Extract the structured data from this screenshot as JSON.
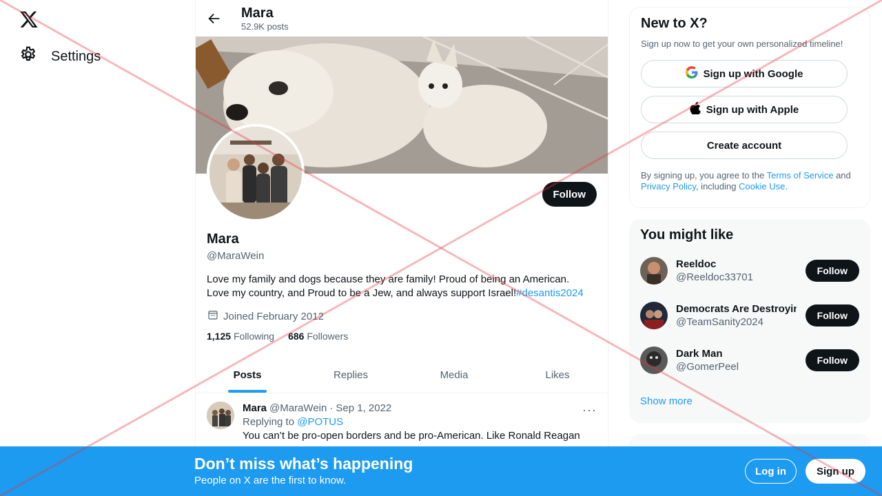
{
  "nav": {
    "settings_label": "Settings"
  },
  "topbar": {
    "name": "Mara",
    "posts": "52.9K posts"
  },
  "profile": {
    "follow_label": "Follow",
    "name": "Mara",
    "handle": "@MaraWein",
    "bio_line1": "Love my family and dogs because they are family! Proud of being an American.",
    "bio_line2": "Love my country, and Proud to be a Jew, and always support Israel!",
    "bio_hashtag": "#desantis2024",
    "joined": "Joined February 2012",
    "following_count": "1,125",
    "following_label": "Following",
    "followers_count": "686",
    "followers_label": "Followers"
  },
  "tabs": [
    {
      "label": "Posts"
    },
    {
      "label": "Replies"
    },
    {
      "label": "Media"
    },
    {
      "label": "Likes"
    }
  ],
  "tweet": {
    "name": "Mara",
    "handle": "@MaraWein",
    "separator": "·",
    "date": "Sep 1, 2022",
    "more": "···",
    "replying_prefix": "Replying to",
    "replying_handle": "@POTUS",
    "text": "You can’t be pro-open borders and be pro-American.  Like Ronald Reagan"
  },
  "new_to_x": {
    "title": "New to X?",
    "subtitle": "Sign up now to get your own personalized timeline!",
    "google_label": "Sign up with Google",
    "apple_label": "Sign up with Apple",
    "create_label": "Create account",
    "legal_1": "By signing up, you agree to the",
    "legal_tos": "Terms of Service",
    "legal_2": "and",
    "legal_privacy": "Privacy Policy",
    "legal_3": ", including",
    "legal_cookie": "Cookie Use",
    "legal_4": "."
  },
  "you_might_like": {
    "title": "You might like",
    "users": [
      {
        "name": "Reeldoc",
        "handle": "@Reeldoc33701",
        "follow": "Follow"
      },
      {
        "name": "Democrats Are Destroying",
        "handle": "@TeamSanity2024",
        "follow": "Follow"
      },
      {
        "name": "Dark Man",
        "handle": "@GomerPeel",
        "follow": "Follow"
      }
    ],
    "show_more": "Show more"
  },
  "bottom_bar": {
    "title": "Don’t miss what’s happening",
    "subtitle": "People on X are the first to know.",
    "login": "Log in",
    "signup": "Sign up"
  },
  "colors": {
    "accent": "#1d9bf0",
    "text": "#0f1419",
    "muted": "#536471"
  }
}
